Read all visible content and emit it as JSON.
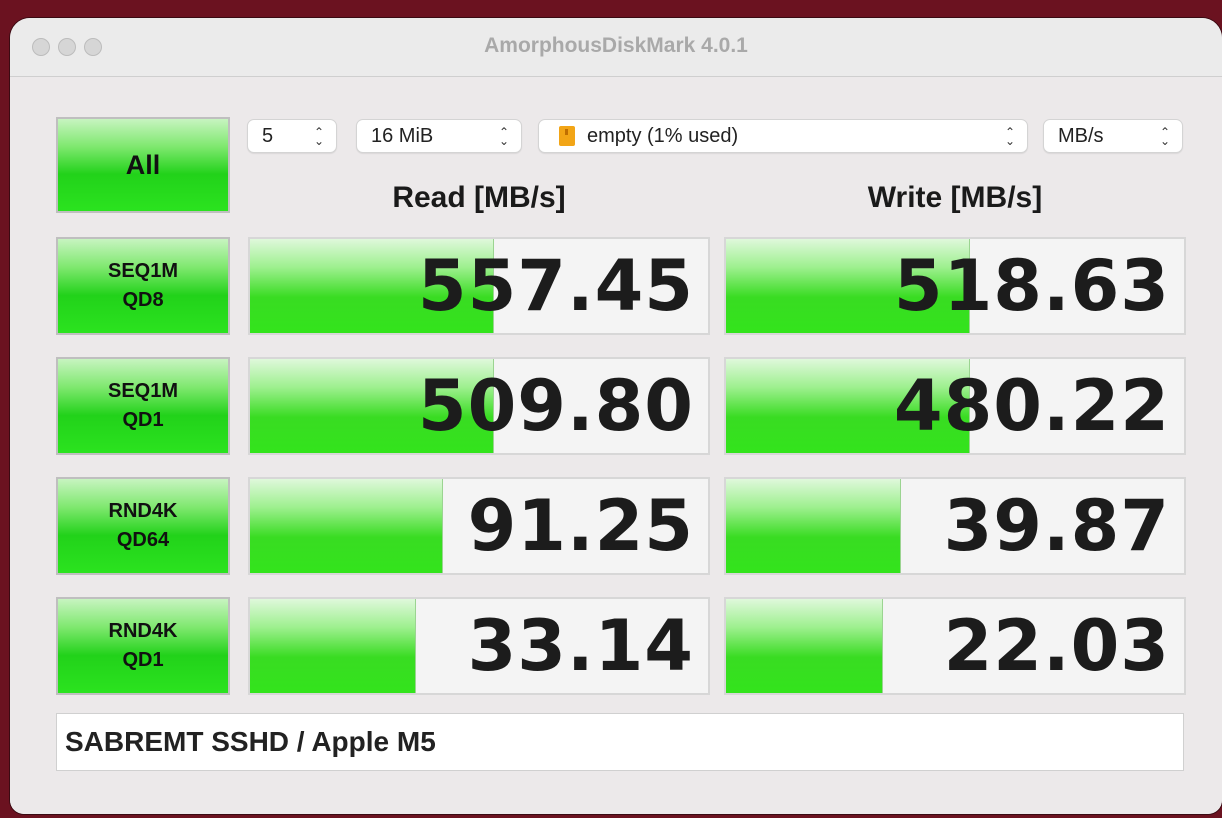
{
  "window": {
    "title": "AmorphousDiskMark 4.0.1"
  },
  "toolbar": {
    "count": {
      "value": "5"
    },
    "size": {
      "value": "16 MiB"
    },
    "volume": {
      "value": "empty (1% used)",
      "icon": "drive-icon"
    },
    "unit": {
      "value": "MB/s"
    }
  },
  "all_button": {
    "label": "All"
  },
  "columns": {
    "read": "Read [MB/s]",
    "write": "Write [MB/s]"
  },
  "tests": [
    {
      "line1": "SEQ1M",
      "line2": "QD8",
      "read": "557.45",
      "write": "518.63",
      "read_fill": 0.53,
      "write_fill": 0.53
    },
    {
      "line1": "SEQ1M",
      "line2": "QD1",
      "read": "509.80",
      "write": "480.22",
      "read_fill": 0.53,
      "write_fill": 0.53
    },
    {
      "line1": "RND4K",
      "line2": "QD64",
      "read": "91.25",
      "write": "39.87",
      "read_fill": 0.42,
      "write_fill": 0.38
    },
    {
      "line1": "RND4K",
      "line2": "QD1",
      "read": "33.14",
      "write": "22.03",
      "read_fill": 0.36,
      "write_fill": 0.34
    }
  ],
  "device": {
    "label": "SABREMT SSHD / Apple M5"
  },
  "colors": {
    "accent_green": "#2be31f",
    "background": "#6b1220"
  }
}
